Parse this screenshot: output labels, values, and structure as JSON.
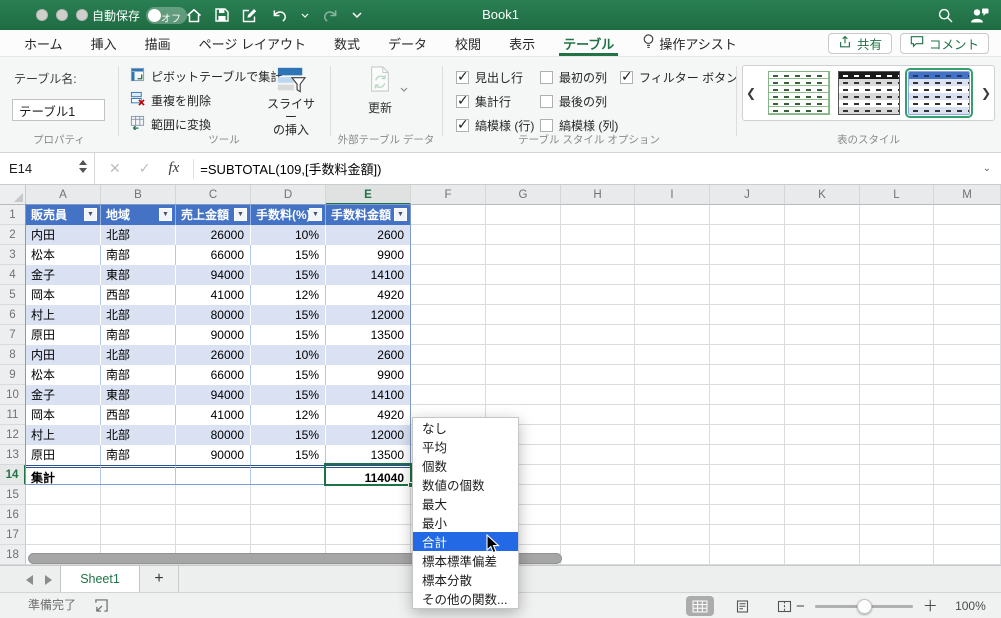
{
  "titlebar": {
    "autosave_label": "自動保存",
    "autosave_state": "オフ",
    "title": "Book1"
  },
  "ribbon_tabs": [
    {
      "label": "ホーム"
    },
    {
      "label": "挿入"
    },
    {
      "label": "描画"
    },
    {
      "label": "ページ レイアウト"
    },
    {
      "label": "数式"
    },
    {
      "label": "データ"
    },
    {
      "label": "校閲"
    },
    {
      "label": "表示"
    },
    {
      "label": "テーブル",
      "active": true
    },
    {
      "label": "操作アシスト",
      "icon": "lightbulb"
    }
  ],
  "header_actions": {
    "share": "共有",
    "comments": "コメント"
  },
  "ribbon": {
    "properties": {
      "table_name_label": "テーブル名:",
      "table_name_value": "テーブル1",
      "group_label": "プロパティ"
    },
    "tools": {
      "buttons": [
        {
          "label": "ピボットテーブルで集計",
          "icon": "pivot-table-icon"
        },
        {
          "label": "重複を削除",
          "icon": "remove-duplicates-icon"
        },
        {
          "label": "範囲に変換",
          "icon": "convert-to-range-icon"
        }
      ],
      "slicer_label_line1": "スライサー",
      "slicer_label_line2": "の挿入",
      "group_label": "ツール"
    },
    "external": {
      "refresh_label": "更新",
      "group_label": "外部テーブル データ"
    },
    "style_options": {
      "items": [
        {
          "label": "見出し行",
          "checked": true
        },
        {
          "label": "集計行",
          "checked": true
        },
        {
          "label": "縞模様 (行)",
          "checked": true
        },
        {
          "label": "最初の列",
          "checked": false
        },
        {
          "label": "最後の列",
          "checked": false
        },
        {
          "label": "縞模様 (列)",
          "checked": false
        },
        {
          "label": "フィルター ボタン",
          "checked": true
        }
      ],
      "group_label": "テーブル スタイル オプション"
    },
    "styles": {
      "group_label": "表のスタイル",
      "selected_index": 2,
      "thumbnails": [
        "table-style-light-green",
        "table-style-dark",
        "table-style-medium-blue"
      ]
    }
  },
  "formula_bar": {
    "cell_ref": "E14",
    "fx_label": "fx",
    "formula": "=SUBTOTAL(109,[手数料金額])"
  },
  "grid": {
    "column_letters": [
      "A",
      "B",
      "C",
      "D",
      "E",
      "F",
      "G",
      "H",
      "I",
      "J",
      "K",
      "L",
      "M"
    ],
    "selected_column": "E",
    "selected_row": 14,
    "row_count": 18,
    "table": {
      "headers": [
        "販売員",
        "地域",
        "売上金額",
        "手数料(%)",
        "手数料金額"
      ],
      "rows": [
        [
          "内田",
          "北部",
          "26000",
          "10%",
          "2600"
        ],
        [
          "松本",
          "南部",
          "66000",
          "15%",
          "9900"
        ],
        [
          "金子",
          "東部",
          "94000",
          "15%",
          "14100"
        ],
        [
          "岡本",
          "西部",
          "41000",
          "12%",
          "4920"
        ],
        [
          "村上",
          "北部",
          "80000",
          "15%",
          "12000"
        ],
        [
          "原田",
          "南部",
          "90000",
          "15%",
          "13500"
        ],
        [
          "内田",
          "北部",
          "26000",
          "10%",
          "2600"
        ],
        [
          "松本",
          "南部",
          "66000",
          "15%",
          "9900"
        ],
        [
          "金子",
          "東部",
          "94000",
          "15%",
          "14100"
        ],
        [
          "岡本",
          "西部",
          "41000",
          "12%",
          "4920"
        ],
        [
          "村上",
          "北部",
          "80000",
          "15%",
          "12000"
        ],
        [
          "原田",
          "南部",
          "90000",
          "15%",
          "13500"
        ]
      ],
      "total_label": "集計",
      "total_value": "114040"
    }
  },
  "subtotal_menu": {
    "items": [
      "なし",
      "平均",
      "個数",
      "数値の個数",
      "最大",
      "最小",
      "合計",
      "標本標準偏差",
      "標本分散",
      "その他の関数..."
    ],
    "selected": "合計"
  },
  "sheet_bar": {
    "active_tab": "Sheet1",
    "add_label": "+"
  },
  "status_bar": {
    "status": "準備完了",
    "zoom_label": "100%"
  },
  "colors": {
    "excel_green": "#217346",
    "table_header_blue": "#4472C4",
    "band_blue": "#D9E1F2",
    "menu_selection_blue": "#2369E6"
  }
}
